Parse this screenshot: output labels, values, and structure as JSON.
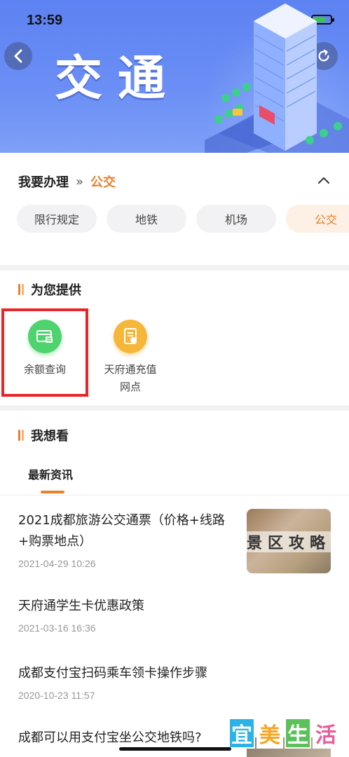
{
  "status_bar": {
    "time": "13:59"
  },
  "header": {
    "title": "交通",
    "back_icon": "chevron-left-icon",
    "favorite_icon": "star-icon",
    "refresh_icon": "refresh-icon",
    "gradient_color": "#6b8ff5"
  },
  "handle": {
    "label": "我要办理",
    "separator": "»",
    "current": "公交",
    "accent_color": "#e8812a",
    "categories": [
      {
        "label": "限行规定",
        "active": false
      },
      {
        "label": "地铁",
        "active": false
      },
      {
        "label": "机场",
        "active": false
      },
      {
        "label": "公交",
        "active": true
      }
    ]
  },
  "services": {
    "title": "为您提供",
    "items": [
      {
        "label": "余额查询",
        "icon": "card-icon",
        "color": "#4fd36e",
        "highlighted": true
      },
      {
        "label_line1": "天府通充值",
        "label_line2": "网点",
        "icon": "document-icon",
        "color": "#f6b63a"
      }
    ],
    "highlight_color": "#e8262a"
  },
  "watch": {
    "title": "我想看",
    "tabs": [
      {
        "label": "最新资讯",
        "active": true
      }
    ],
    "news": [
      {
        "title": "2021成都旅游公交通票（价格+线路+购票地点）",
        "date": "2021-04-29 10:26",
        "thumb_text": "景区攻略"
      },
      {
        "title": "天府通学生卡优惠政策",
        "date": "2021-03-16 16:36"
      },
      {
        "title": "成都支付宝扫码乘车领卡操作步骤",
        "date": "2020-10-23 11:57"
      },
      {
        "title": "成都可以用支付宝坐公交地铁吗?"
      }
    ]
  },
  "watermark": {
    "chars": [
      "宜",
      "美",
      "生",
      "活"
    ],
    "colors": [
      "#2bb3e8",
      "#f5a623",
      "#5cc15a",
      "#e85c9a"
    ]
  }
}
